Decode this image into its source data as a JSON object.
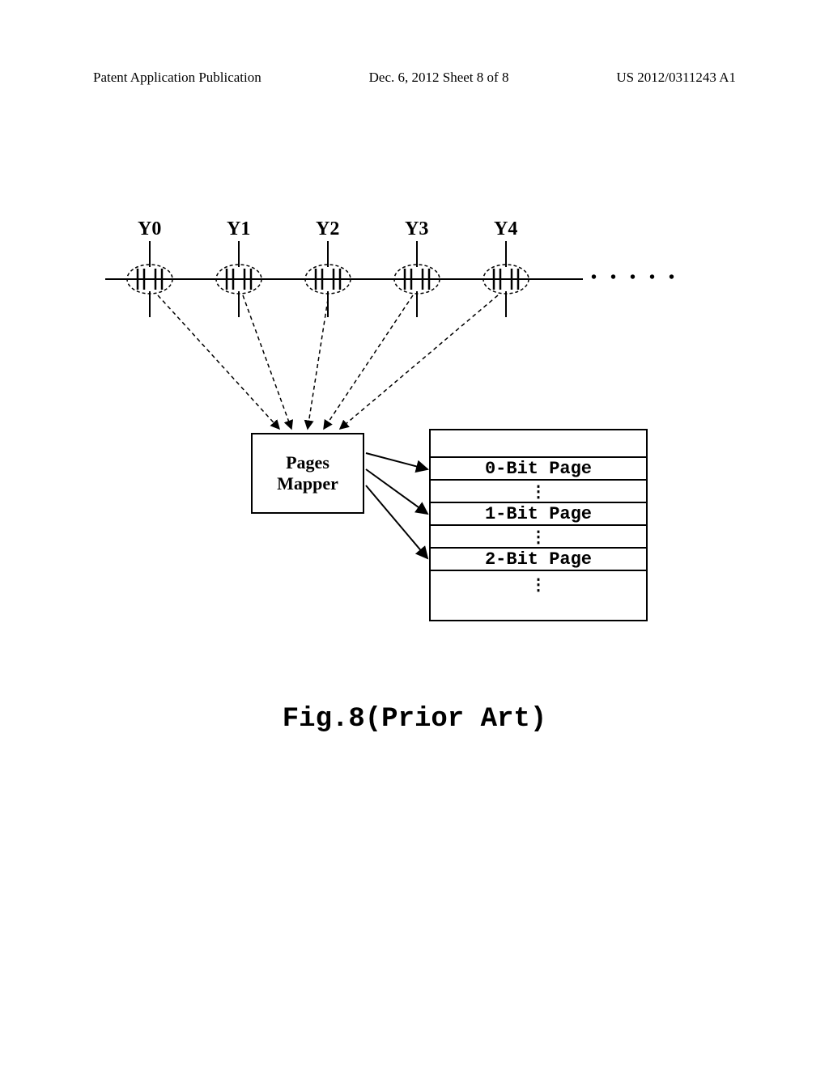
{
  "header": {
    "left": "Patent Application Publication",
    "center": "Dec. 6, 2012  Sheet 8 of 8",
    "right": "US 2012/0311243 A1"
  },
  "columns": [
    "Y0",
    "Y1",
    "Y2",
    "Y3",
    "Y4"
  ],
  "continuation": "• • • • •",
  "mapper": {
    "line1": "Pages",
    "line2": "Mapper"
  },
  "pages": {
    "row0": "0-Bit Page",
    "row1": "1-Bit Page",
    "row2": "2-Bit Page"
  },
  "caption": "Fig.8(Prior Art)"
}
